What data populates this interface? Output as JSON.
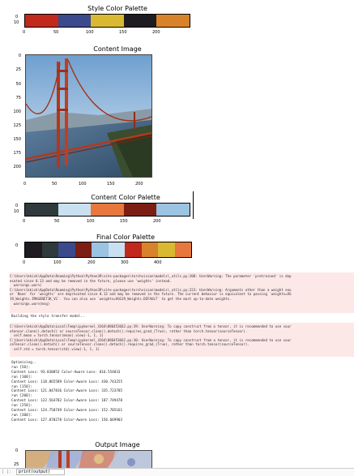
{
  "style_palette": {
    "title": "Style Color Palette",
    "y_ticks": [
      "0",
      "10"
    ],
    "x_ticks": [
      "0",
      "50",
      "100",
      "150",
      "200"
    ],
    "colors": [
      "#c0291c",
      "#3b4a8c",
      "#d9b931",
      "#1e1c21",
      "#d8832b"
    ]
  },
  "content_image": {
    "title": "Content Image",
    "y_ticks": [
      "0",
      "25",
      "50",
      "75",
      "100",
      "125",
      "150",
      "175",
      "200"
    ],
    "x_ticks": [
      "0",
      "50",
      "100",
      "150",
      "200"
    ]
  },
  "content_palette": {
    "title": "Content Color Palette",
    "y_ticks": [
      "0",
      "10"
    ],
    "x_ticks": [
      "0",
      "50",
      "100",
      "150",
      "200"
    ],
    "colors": [
      "#2f3a3c",
      "#c9e0f1",
      "#e7773d",
      "#7c1e13",
      "#9bc3e2"
    ]
  },
  "final_palette": {
    "title": "Final Color Palette",
    "y_ticks": [
      "0"
    ],
    "x_ticks": [
      "0",
      "100",
      "200",
      "300",
      "400"
    ],
    "colors": [
      "#1e1c21",
      "#2f3a3c",
      "#3b4a8c",
      "#7c1e13",
      "#9bc3e2",
      "#c9e0f1",
      "#c0291c",
      "#d8832b",
      "#d9b931",
      "#e7773d"
    ]
  },
  "warnings_1": [
    "C:\\Users\\kkick\\AppData\\Roaming\\Python\\Python39\\site-packages\\torchvision\\models\\_utils.py:208: UserWarning: The parameter 'pretrained' is dep",
    "ecated since 0.13 and may be removed in the future, please use 'weights' instead.",
    "  warnings.warn(",
    "C:\\Users\\kkick\\AppData\\Roaming\\Python\\Python39\\site-packages\\torchvision\\models\\_utils.py:223: UserWarning: Arguments other than a weight enu",
    "or `None` for 'weights' are deprecated since 0.13 and may be removed in the future. The current behavior is equivalent to passing `weights=VG",
    "19_Weights.IMAGENET1K_V1`. You can also use `weights=VGG19_Weights.DEFAULT` to get the most up-to-date weights.",
    "  warnings.warn(msg)"
  ],
  "building_line": "Building the style transfer model..",
  "warnings_2": [
    "C:\\Users\\kkick\\AppData\\Local\\Temp\\ipykernel_4164\\886453662.py:39: UserWarning: To copy construct from a tensor, it is recommended to use sour",
    "etensor.clone().detach() or sourceTensor.clone().detach().requires_grad_(True), rather than torch.tensor(sourceTensor).",
    "  self.mean = torch.tensor(mean).view(-1, 1, 1)",
    "C:\\Users\\kkick\\AppData\\Local\\Temp\\ipykernel_4164\\886453662.py:30: UserWarning: To copy construct from a tensor, it is recommended to use sour",
    "ceTensor.clone().detach() or sourceTensor.clone().detach().requires_grad_(True), rather than torch.tensor(sourceTensor).",
    "  self.std = torch.tensor(std).view(-1, 1, 1)"
  ],
  "output_lines": [
    "Optimizing..",
    "run [50]:",
    "Content Loss: 93.830853 Color-Aware Loss: 816.554833",
    "run [100]:",
    "Content Loss: 118.865589 Color-Aware Loss: 430.743255",
    "run [150]:",
    "Content Loss: 121.047816 Color-Aware Loss: 335.723785",
    "run [200]:",
    "Content Loss: 122.564782 Color-Aware Loss: 187.749478",
    "run [250]:",
    "Content Loss: 124.750749 Color-Aware Loss: 152.705161",
    "run [300]:",
    "Content Loss: 127.070278 Color-Aware Loss: 156.669903"
  ],
  "output_image": {
    "title": "Output Image",
    "y_ticks": [
      "0",
      "25"
    ]
  },
  "cell_bar": {
    "prompt": "[ ]:",
    "code": "print(output)"
  }
}
